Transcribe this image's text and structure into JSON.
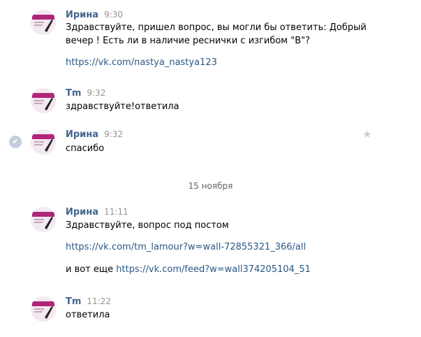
{
  "messages": [
    {
      "author": "Ирина",
      "time": "9:30",
      "lines": [
        "Здравствуйте, пришел вопрос, вы могли бы ответить: Добрый",
        "вечер ! Есть ли в наличие реснички с изгибом \"В\"?"
      ],
      "link": "https://vk.com/nastya_nastya123"
    },
    {
      "author": "Tm",
      "time": "9:32",
      "lines": [
        "здравствуйте!ответила"
      ]
    },
    {
      "author": "Ирина",
      "time": "9:32",
      "lines": [
        "спасибо"
      ]
    },
    {
      "author": "Ирина",
      "time": "11:11",
      "lines": [
        "Здравствуйте, вопрос под постом"
      ],
      "link": "https://vk.com/tm_lamour?w=wall-72855321_366/all",
      "extra_prefix": "и вот еще ",
      "extra_link": "https://vk.com/feed?w=wall374205104_51"
    },
    {
      "author": "Tm",
      "time": "11:22",
      "lines": [
        "ответила"
      ]
    }
  ],
  "date_separator": "15 ноября",
  "icons": {
    "read_check": "check-icon",
    "favorite": "star-icon"
  },
  "colors": {
    "author": "#42648b",
    "link": "#2a5885",
    "time": "#939393",
    "avatar_accent": "#b0267a"
  }
}
